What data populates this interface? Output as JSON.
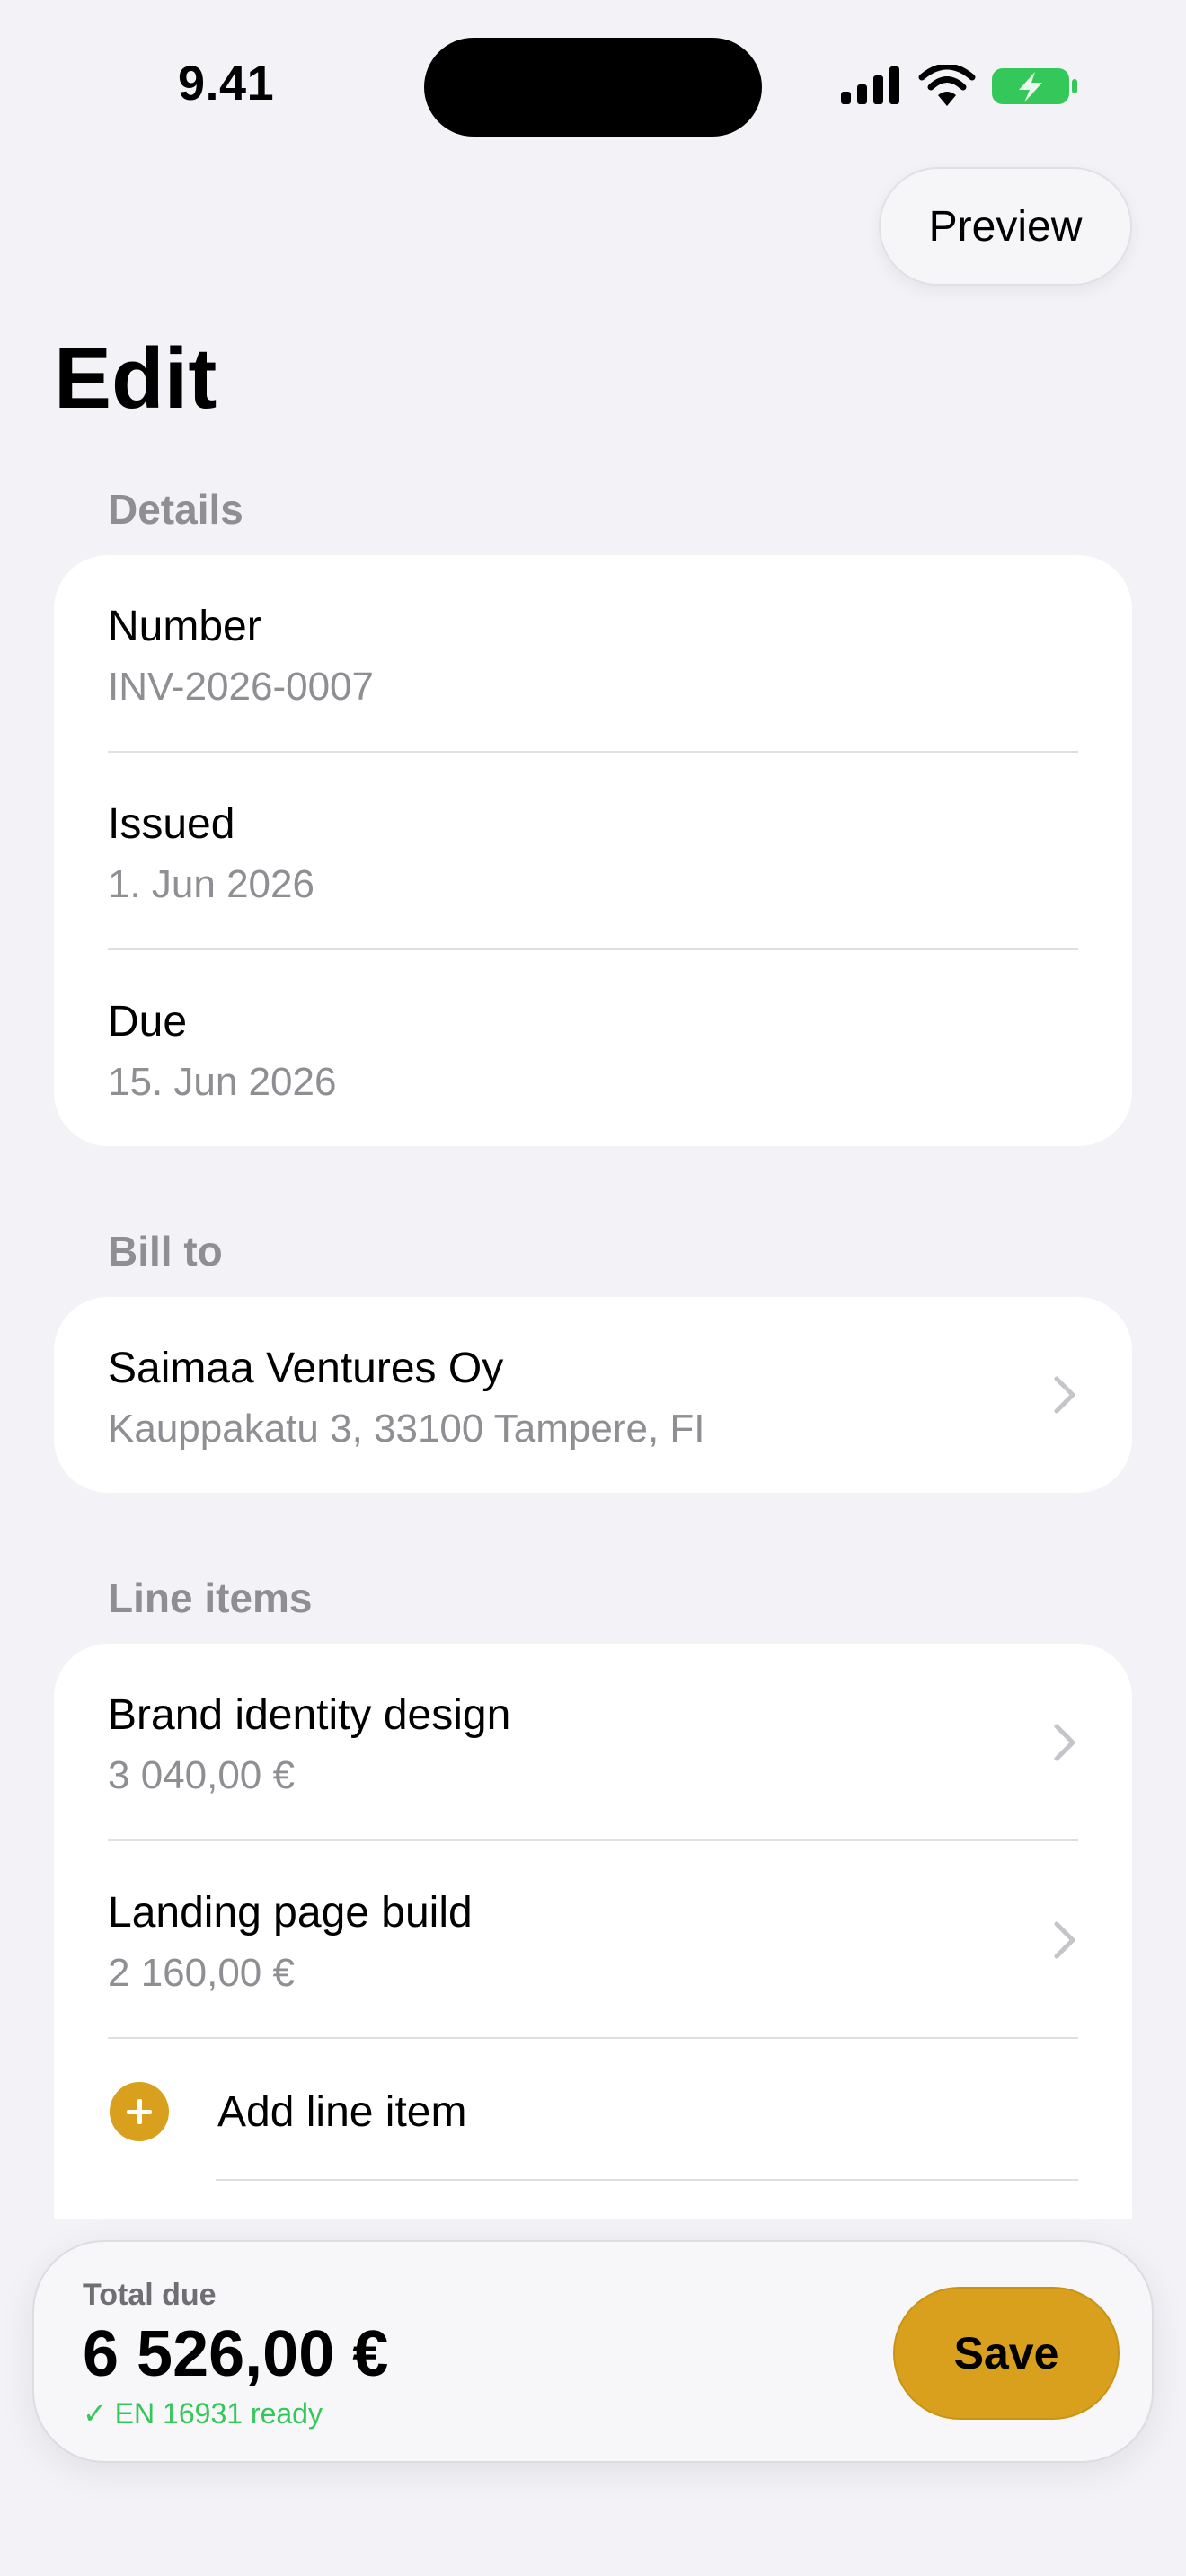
{
  "status_bar": {
    "time": "9.41",
    "icons": [
      "cellular-signal-icon",
      "wifi-icon",
      "battery-charging-icon"
    ],
    "battery_color": "#34c759"
  },
  "header": {
    "preview_label": "Preview",
    "title": "Edit"
  },
  "details": {
    "header": "Details",
    "rows": [
      {
        "label": "Number",
        "value": "INV-2026-0007"
      },
      {
        "label": "Issued",
        "value": "1. Jun 2026"
      },
      {
        "label": "Due",
        "value": "15. Jun 2026"
      }
    ]
  },
  "bill_to": {
    "header": "Bill to",
    "name": "Saimaa Ventures Oy",
    "address": "Kauppakatu 3, 33100 Tampere, FI"
  },
  "line_items": {
    "header": "Line items",
    "items": [
      {
        "name": "Brand identity design",
        "amount": "3 040,00 €"
      },
      {
        "name": "Landing page build",
        "amount": "2 160,00 €"
      }
    ],
    "add_label": "Add line item"
  },
  "footer": {
    "total_label": "Total due",
    "total_value": "6 526,00 €",
    "ready_text": "✓ EN 16931 ready",
    "save_label": "Save"
  },
  "colors": {
    "accent": "#d8a01c",
    "success": "#34c759",
    "background": "#f2f2f7",
    "secondary_text": "#8e8e93"
  }
}
